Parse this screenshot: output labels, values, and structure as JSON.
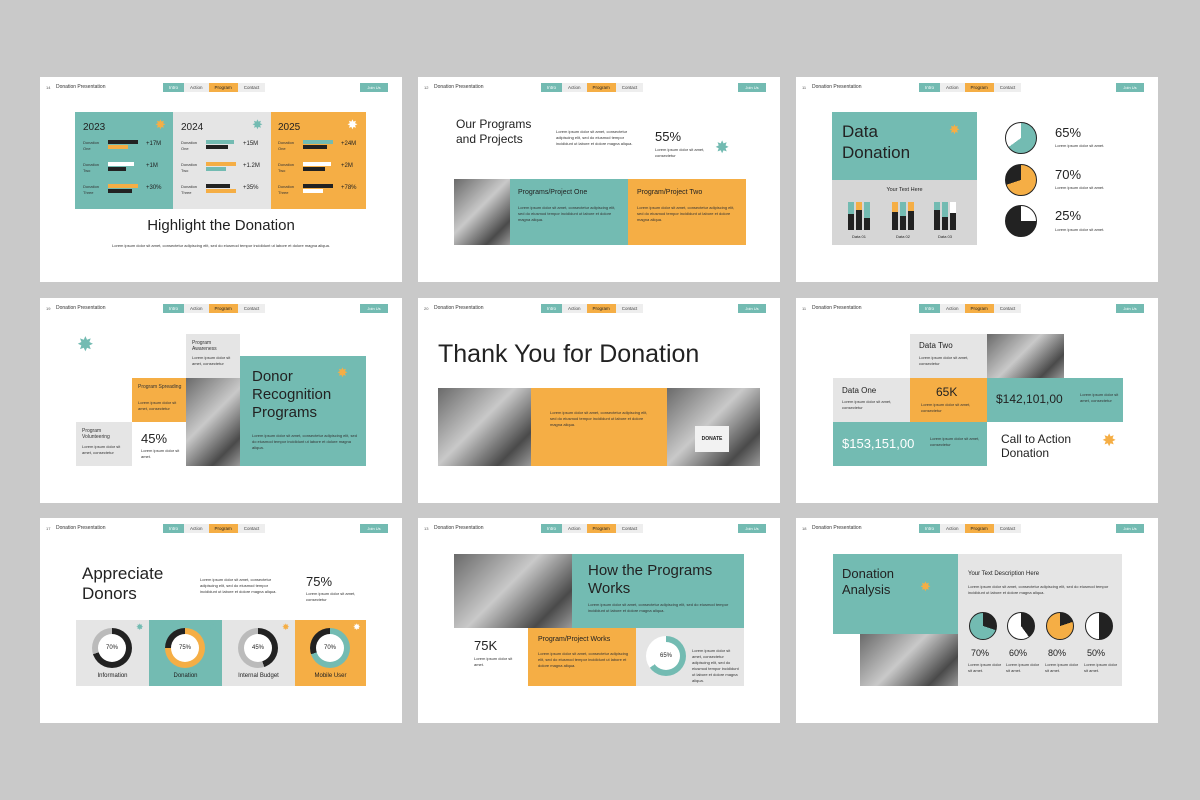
{
  "common": {
    "deck_title": "Donation Presentation",
    "nav": [
      "Intro",
      "Action",
      "Program",
      "Contact"
    ],
    "join": "Join Us",
    "lorem_short": "Lorem ipsum dolor sit amet.",
    "lorem_mid": "Lorem ipsum dolor sit amet, consectetur adipiscing elit, sed do eiusmod tempor incididunt ut labore et dolore magna aliqua.",
    "lorem_two": "Lorem ipsum dolor sit amet, consectetur"
  },
  "colors": {
    "teal": "#73bbb2",
    "orange": "#f5ae45",
    "gray": "#e5e5e5",
    "background": "#c9c9c9"
  },
  "slide1": {
    "num": "14",
    "years": [
      "2023",
      "2024",
      "2025"
    ],
    "rows": [
      "Donation One",
      "Donation Two",
      "Donation Three"
    ],
    "values": [
      [
        "+17M",
        "+1M",
        "+30%"
      ],
      [
        "+15M",
        "+1.2M",
        "+35%"
      ],
      [
        "+24M",
        "+2M",
        "+78%"
      ]
    ],
    "title": "Highlight the Donation",
    "body": "Lorem ipsum dolor sit amet, consectetur adipiscing elit, sed do eiusmod tempor incididunt ut labore et dolore magna aliqua."
  },
  "slide2": {
    "num": "12",
    "title": "Our Programs and Projects",
    "stat": "55%",
    "card1_title": "Programs/Project One",
    "card2_title": "Program/Project Two"
  },
  "slide3": {
    "num": "11",
    "title": "Data Donation",
    "chart_label": "Your Text Here",
    "bars": [
      "Data 01",
      "Data 02",
      "Data 03"
    ],
    "pies": [
      "65%",
      "70%",
      "25%"
    ]
  },
  "slide4": {
    "num": "19",
    "title": "Donor Recognition Programs",
    "steps": [
      "Program Awareness",
      "Program Spreading",
      "Program Volunteering"
    ],
    "stat": "45%"
  },
  "slide5": {
    "num": "20",
    "title": "Thank You for Donation",
    "box_text": "DONATE"
  },
  "slide6": {
    "num": "11",
    "data_two": "Data Two",
    "data_one": "Data One",
    "v1": "65K",
    "v2": "$142,101,00",
    "v3": "$153,151,00",
    "cta": "Call to Action Donation"
  },
  "slide7": {
    "num": "17",
    "title": "Appreciate Donors",
    "stat": "75%",
    "rings": [
      {
        "value": "70%",
        "label": "Information"
      },
      {
        "value": "75%",
        "label": "Donation"
      },
      {
        "value": "45%",
        "label": "Internal Budget"
      },
      {
        "value": "70%",
        "label": "Mobile User"
      }
    ]
  },
  "slide8": {
    "num": "13",
    "title": "How the Programs Works",
    "stat": "75K",
    "card_title": "Program/Project Works",
    "ring": "65%"
  },
  "slide9": {
    "num": "18",
    "title": "Donation Analysis",
    "desc_title": "Your Text Description Here",
    "pies": [
      "70%",
      "60%",
      "80%",
      "50%"
    ]
  }
}
